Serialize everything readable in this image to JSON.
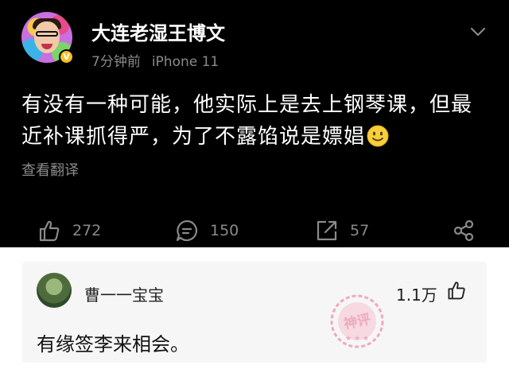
{
  "post": {
    "username": "大连老湿王博文",
    "time": "7分钟前",
    "device": "iPhone 11",
    "verified_badge": "V",
    "content": "有没有一种可能，他实际上是去上钢琴课，但最近补课抓得严，为了不露馅说是嫖娼",
    "emoji": "slightly-smiling-face",
    "translate_label": "查看翻译",
    "actions": {
      "likes": "272",
      "comments": "150",
      "reposts": "57"
    }
  },
  "comment": {
    "username": "曹一一宝宝",
    "likes": "1.1万",
    "text": "有缘签李来相会。",
    "badge": "神评"
  },
  "colors": {
    "background_dark": "#000000",
    "secondary_text": "#8a8a8a",
    "verified": "#f5c02a",
    "stamp": "#e8507a"
  }
}
